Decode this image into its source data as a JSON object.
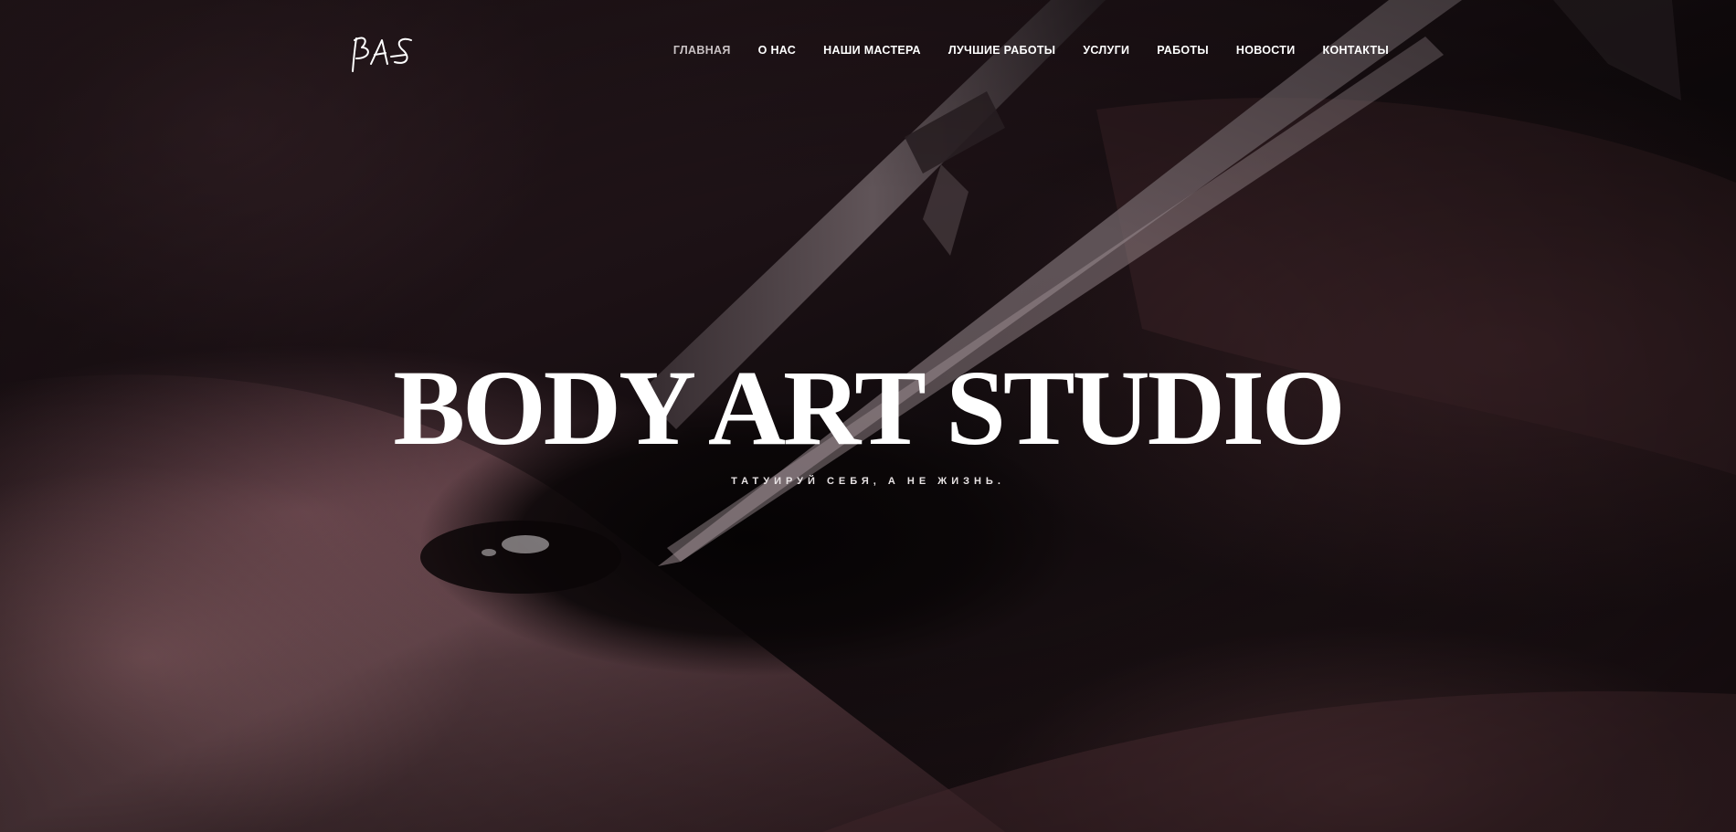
{
  "logo": {
    "text": "BAS",
    "icon": "bas-signature-logo"
  },
  "nav": {
    "items": [
      {
        "label": "ГЛАВНАЯ",
        "active": true
      },
      {
        "label": "О НАС"
      },
      {
        "label": "НАШИ МАСТЕРА"
      },
      {
        "label": "ЛУЧШИЕ РАБОТЫ"
      },
      {
        "label": "УСЛУГИ"
      },
      {
        "label": "РАБОТЫ"
      },
      {
        "label": "НОВОСТИ"
      },
      {
        "label": "КОНТАКТЫ"
      }
    ]
  },
  "hero": {
    "title": "BODY ART STUDIO",
    "subtitle": "ТАТУИРУЙ СЕБЯ, А НЕ ЖИЗНЬ.",
    "background": "tattoo-needle-close-up-photo"
  },
  "colors": {
    "text": "#ffffff",
    "nav_active": "#c9c2c4",
    "background_dark": "#0b0708",
    "skin_tone": "#8a5a60"
  }
}
